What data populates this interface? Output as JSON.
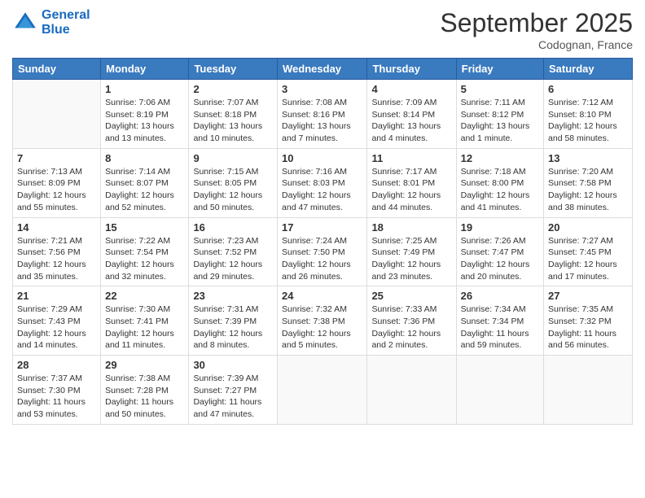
{
  "logo": {
    "line1": "General",
    "line2": "Blue"
  },
  "title": "September 2025",
  "subtitle": "Codognan, France",
  "header_days": [
    "Sunday",
    "Monday",
    "Tuesday",
    "Wednesday",
    "Thursday",
    "Friday",
    "Saturday"
  ],
  "weeks": [
    [
      {
        "day": "",
        "info": ""
      },
      {
        "day": "1",
        "info": "Sunrise: 7:06 AM\nSunset: 8:19 PM\nDaylight: 13 hours\nand 13 minutes."
      },
      {
        "day": "2",
        "info": "Sunrise: 7:07 AM\nSunset: 8:18 PM\nDaylight: 13 hours\nand 10 minutes."
      },
      {
        "day": "3",
        "info": "Sunrise: 7:08 AM\nSunset: 8:16 PM\nDaylight: 13 hours\nand 7 minutes."
      },
      {
        "day": "4",
        "info": "Sunrise: 7:09 AM\nSunset: 8:14 PM\nDaylight: 13 hours\nand 4 minutes."
      },
      {
        "day": "5",
        "info": "Sunrise: 7:11 AM\nSunset: 8:12 PM\nDaylight: 13 hours\nand 1 minute."
      },
      {
        "day": "6",
        "info": "Sunrise: 7:12 AM\nSunset: 8:10 PM\nDaylight: 12 hours\nand 58 minutes."
      }
    ],
    [
      {
        "day": "7",
        "info": "Sunrise: 7:13 AM\nSunset: 8:09 PM\nDaylight: 12 hours\nand 55 minutes."
      },
      {
        "day": "8",
        "info": "Sunrise: 7:14 AM\nSunset: 8:07 PM\nDaylight: 12 hours\nand 52 minutes."
      },
      {
        "day": "9",
        "info": "Sunrise: 7:15 AM\nSunset: 8:05 PM\nDaylight: 12 hours\nand 50 minutes."
      },
      {
        "day": "10",
        "info": "Sunrise: 7:16 AM\nSunset: 8:03 PM\nDaylight: 12 hours\nand 47 minutes."
      },
      {
        "day": "11",
        "info": "Sunrise: 7:17 AM\nSunset: 8:01 PM\nDaylight: 12 hours\nand 44 minutes."
      },
      {
        "day": "12",
        "info": "Sunrise: 7:18 AM\nSunset: 8:00 PM\nDaylight: 12 hours\nand 41 minutes."
      },
      {
        "day": "13",
        "info": "Sunrise: 7:20 AM\nSunset: 7:58 PM\nDaylight: 12 hours\nand 38 minutes."
      }
    ],
    [
      {
        "day": "14",
        "info": "Sunrise: 7:21 AM\nSunset: 7:56 PM\nDaylight: 12 hours\nand 35 minutes."
      },
      {
        "day": "15",
        "info": "Sunrise: 7:22 AM\nSunset: 7:54 PM\nDaylight: 12 hours\nand 32 minutes."
      },
      {
        "day": "16",
        "info": "Sunrise: 7:23 AM\nSunset: 7:52 PM\nDaylight: 12 hours\nand 29 minutes."
      },
      {
        "day": "17",
        "info": "Sunrise: 7:24 AM\nSunset: 7:50 PM\nDaylight: 12 hours\nand 26 minutes."
      },
      {
        "day": "18",
        "info": "Sunrise: 7:25 AM\nSunset: 7:49 PM\nDaylight: 12 hours\nand 23 minutes."
      },
      {
        "day": "19",
        "info": "Sunrise: 7:26 AM\nSunset: 7:47 PM\nDaylight: 12 hours\nand 20 minutes."
      },
      {
        "day": "20",
        "info": "Sunrise: 7:27 AM\nSunset: 7:45 PM\nDaylight: 12 hours\nand 17 minutes."
      }
    ],
    [
      {
        "day": "21",
        "info": "Sunrise: 7:29 AM\nSunset: 7:43 PM\nDaylight: 12 hours\nand 14 minutes."
      },
      {
        "day": "22",
        "info": "Sunrise: 7:30 AM\nSunset: 7:41 PM\nDaylight: 12 hours\nand 11 minutes."
      },
      {
        "day": "23",
        "info": "Sunrise: 7:31 AM\nSunset: 7:39 PM\nDaylight: 12 hours\nand 8 minutes."
      },
      {
        "day": "24",
        "info": "Sunrise: 7:32 AM\nSunset: 7:38 PM\nDaylight: 12 hours\nand 5 minutes."
      },
      {
        "day": "25",
        "info": "Sunrise: 7:33 AM\nSunset: 7:36 PM\nDaylight: 12 hours\nand 2 minutes."
      },
      {
        "day": "26",
        "info": "Sunrise: 7:34 AM\nSunset: 7:34 PM\nDaylight: 11 hours\nand 59 minutes."
      },
      {
        "day": "27",
        "info": "Sunrise: 7:35 AM\nSunset: 7:32 PM\nDaylight: 11 hours\nand 56 minutes."
      }
    ],
    [
      {
        "day": "28",
        "info": "Sunrise: 7:37 AM\nSunset: 7:30 PM\nDaylight: 11 hours\nand 53 minutes."
      },
      {
        "day": "29",
        "info": "Sunrise: 7:38 AM\nSunset: 7:28 PM\nDaylight: 11 hours\nand 50 minutes."
      },
      {
        "day": "30",
        "info": "Sunrise: 7:39 AM\nSunset: 7:27 PM\nDaylight: 11 hours\nand 47 minutes."
      },
      {
        "day": "",
        "info": ""
      },
      {
        "day": "",
        "info": ""
      },
      {
        "day": "",
        "info": ""
      },
      {
        "day": "",
        "info": ""
      }
    ]
  ]
}
